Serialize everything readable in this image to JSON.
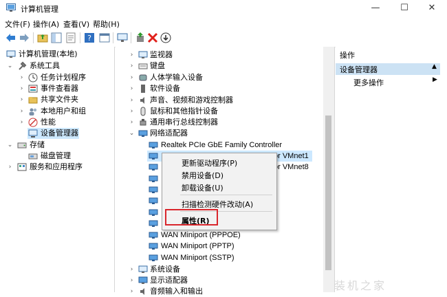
{
  "window": {
    "title": "计算机管理"
  },
  "window_controls": {
    "minimize": "—",
    "maximize": "☐",
    "close": "✕"
  },
  "menu": [
    "文件(F)",
    "操作(A)",
    "查看(V)",
    "帮助(H)"
  ],
  "toolbar": {
    "buttons": [
      "back-icon",
      "forward-icon",
      "up-folder-icon",
      "show-tree-icon",
      "properties-icon",
      "help-icon",
      "console-icon",
      "monitor-icon",
      "update-driver-icon",
      "uninstall-icon",
      "download-icon"
    ],
    "colors": {
      "arrow": "#2f7dd1",
      "uninstall": "#e0201b",
      "green": "#2e9a2e"
    }
  },
  "left_tree": [
    {
      "label": "计算机管理(本地)",
      "level": 0,
      "expanded": true,
      "icon": "computer-management-icon"
    },
    {
      "label": "系统工具",
      "level": 1,
      "expanded": true,
      "icon": "tools-icon"
    },
    {
      "label": "任务计划程序",
      "level": 2,
      "expanded": false,
      "icon": "clock-icon"
    },
    {
      "label": "事件查看器",
      "level": 2,
      "expanded": false,
      "icon": "event-viewer-icon"
    },
    {
      "label": "共享文件夹",
      "level": 2,
      "expanded": false,
      "icon": "shared-folder-icon"
    },
    {
      "label": "本地用户和组",
      "level": 2,
      "expanded": false,
      "icon": "users-icon"
    },
    {
      "label": "性能",
      "level": 2,
      "expanded": false,
      "icon": "performance-icon"
    },
    {
      "label": "设备管理器",
      "level": 2,
      "selected": true,
      "icon": "device-manager-icon"
    },
    {
      "label": "存储",
      "level": 1,
      "expanded": true,
      "icon": "storage-icon"
    },
    {
      "label": "磁盘管理",
      "level": 2,
      "icon": "disk-icon"
    },
    {
      "label": "服务和应用程序",
      "level": 1,
      "expanded": false,
      "icon": "services-icon"
    }
  ],
  "device_tree": [
    {
      "label": "监视器",
      "icon": "monitor-icon",
      "expandable": true,
      "level": 0
    },
    {
      "label": "键盘",
      "icon": "keyboard-icon",
      "expandable": true,
      "level": 0
    },
    {
      "label": "人体学输入设备",
      "icon": "hid-icon",
      "expandable": true,
      "level": 0
    },
    {
      "label": "软件设备",
      "icon": "software-device-icon",
      "expandable": true,
      "level": 0
    },
    {
      "label": "声音、视频和游戏控制器",
      "icon": "sound-icon",
      "expandable": true,
      "level": 0
    },
    {
      "label": "鼠标和其他指针设备",
      "icon": "mouse-icon",
      "expandable": true,
      "level": 0
    },
    {
      "label": "通用串行总线控制器",
      "icon": "usb-icon",
      "expandable": true,
      "level": 0
    },
    {
      "label": "网络适配器",
      "icon": "network-adapter-icon",
      "expanded": true,
      "level": 0
    },
    {
      "label": "Realtek PCIe GbE Family Controller",
      "icon": "network-card-icon",
      "level": 1
    },
    {
      "label": "or VMnet1",
      "icon": "network-card-icon",
      "level": 1,
      "partially_hidden": true,
      "selected": true
    },
    {
      "label": "or VMnet8",
      "icon": "network-card-icon",
      "level": 1,
      "partially_hidden": true
    },
    {
      "label": "",
      "icon": "network-card-icon",
      "level": 1
    },
    {
      "label": "",
      "icon": "network-card-icon",
      "level": 1
    },
    {
      "label": "",
      "icon": "network-card-icon",
      "level": 1
    },
    {
      "label": "",
      "icon": "network-card-icon",
      "level": 1
    },
    {
      "label": "",
      "icon": "network-card-icon",
      "level": 1
    },
    {
      "label": "WAN Miniport (PPPOE)",
      "icon": "network-card-icon",
      "level": 1
    },
    {
      "label": "WAN Miniport (PPTP)",
      "icon": "network-card-icon",
      "level": 1
    },
    {
      "label": "WAN Miniport (SSTP)",
      "icon": "network-card-icon",
      "level": 1
    },
    {
      "label": "系统设备",
      "icon": "system-device-icon",
      "expandable": true,
      "level": 0
    },
    {
      "label": "显示适配器",
      "icon": "display-adapter-icon",
      "expandable": true,
      "level": 0
    },
    {
      "label": "音频输入和输出",
      "icon": "audio-io-icon",
      "expandable": true,
      "level": 0,
      "partially_hidden": true
    }
  ],
  "context_menu": {
    "items": [
      "更新驱动程序(P)",
      "禁用设备(D)",
      "卸载设备(U)",
      "扫描检测硬件改动(A)",
      "属性(R)"
    ],
    "highlighted": "属性(R)",
    "highlight_color": "#d9252b"
  },
  "actions_pane": {
    "header": "操作",
    "section": "设备管理器",
    "items": [
      "更多操作"
    ]
  },
  "watermark": "装机之家"
}
